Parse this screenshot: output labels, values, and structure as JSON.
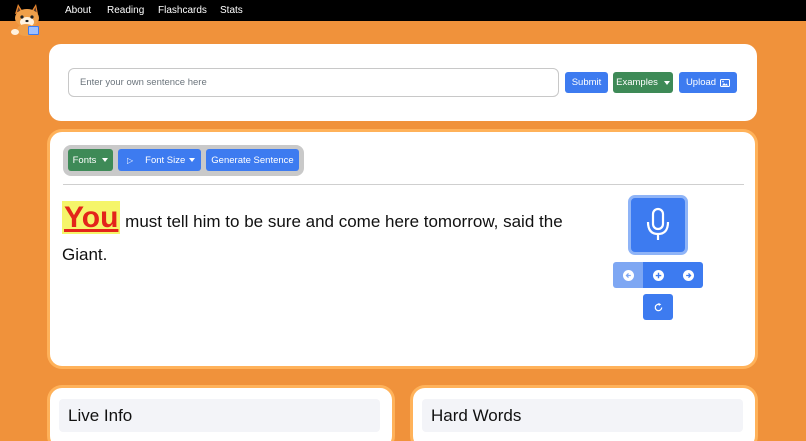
{
  "nav": {
    "items": [
      "About",
      "Reading",
      "Flashcards",
      "Stats"
    ]
  },
  "input_card": {
    "placeholder": "Enter your own sentence here",
    "value": "",
    "submit_label": "Submit",
    "examples_label": "Examples",
    "upload_label": "Upload"
  },
  "toolbar": {
    "fonts_label": "Fonts",
    "play_glyph": "▷",
    "font_size_label": "Font Size",
    "generate_label": "Generate Sentence"
  },
  "reading": {
    "highlighted_word": "You",
    "rest": " must tell him to be sure and come here tomorrow, said the Giant."
  },
  "panels": {
    "live_info_title": "Live Info",
    "hard_words_title": "Hard Words"
  },
  "colors": {
    "background": "#f0923b",
    "primary": "#3d7bf0",
    "success": "#3e8a57",
    "highlight_bg": "#f5f56a",
    "highlight_text": "#e3241b"
  },
  "icons": [
    "logo-fox",
    "upload-image-icon",
    "microphone-icon",
    "arrow-left-icon",
    "plus-icon",
    "arrow-right-icon",
    "reset-icon"
  ]
}
